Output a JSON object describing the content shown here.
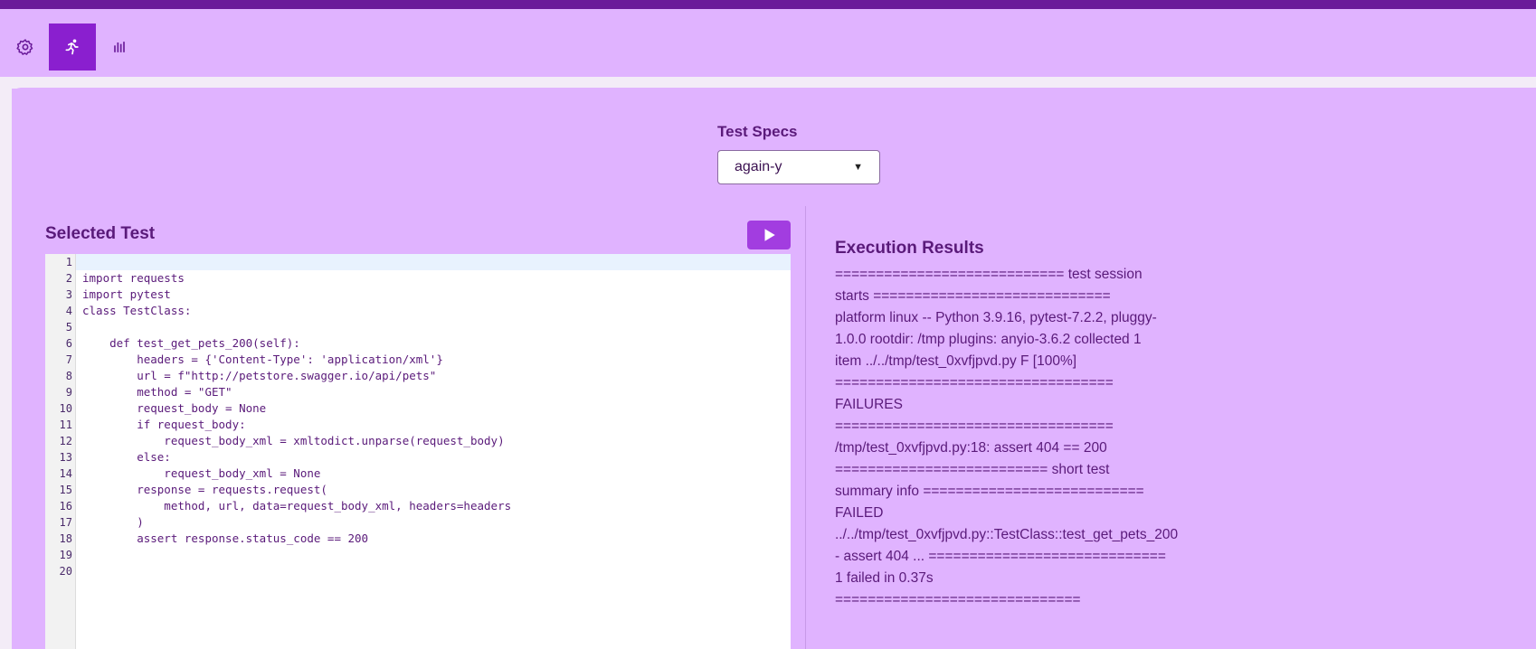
{
  "toolbar": {
    "buttons": [
      {
        "icon": "gear-icon",
        "active": false
      },
      {
        "icon": "running-person-icon",
        "active": true
      },
      {
        "icon": "bar-chart-icon",
        "active": false
      }
    ]
  },
  "test_specs": {
    "label": "Test Specs",
    "selected": "again-y"
  },
  "selected_test": {
    "title": "Selected Test",
    "run_icon": "play-icon",
    "line_numbers": [
      "1",
      "2",
      "3",
      "4",
      "5",
      "6",
      "7",
      "8",
      "9",
      "10",
      "11",
      "12",
      "13",
      "14",
      "15",
      "16",
      "17",
      "18",
      "19",
      "20"
    ],
    "code_lines": [
      "",
      "import requests",
      "import pytest",
      "class TestClass:",
      "",
      "    def test_get_pets_200(self):",
      "        headers = {'Content-Type': 'application/xml'}",
      "        url = f\"http://petstore.swagger.io/api/pets\"",
      "        method = \"GET\"",
      "        request_body = None",
      "        if request_body:",
      "            request_body_xml = xmltodict.unparse(request_body)",
      "        else:",
      "            request_body_xml = None",
      "        response = requests.request(",
      "            method, url, data=request_body_xml, headers=headers",
      "        )",
      "        assert response.status_code == 200",
      "",
      ""
    ]
  },
  "execution_results": {
    "title": "Execution Results",
    "lines": [
      "============================ test session",
      "starts =============================",
      "platform linux -- Python 3.9.16, pytest-7.2.2, pluggy-",
      "1.0.0 rootdir: /tmp plugins: anyio-3.6.2 collected 1",
      "item ../../tmp/test_0xvfjpvd.py F [100%]",
      "==================================",
      "FAILURES",
      "==================================",
      "/tmp/test_0xvfjpvd.py:18: assert 404 == 200",
      "========================== short test",
      "summary info ===========================",
      "FAILED",
      "../../tmp/test_0xvfjpvd.py::TestClass::test_get_pets_200",
      "- assert 404 ... =============================",
      "1 failed in 0.37s",
      "=============================="
    ]
  },
  "colors": {
    "background": "#e0b3ff",
    "topbar": "#6a1b9a",
    "active_tab": "#8a1fcf",
    "run_button": "#a23de0",
    "text": "#5a1a7a"
  }
}
